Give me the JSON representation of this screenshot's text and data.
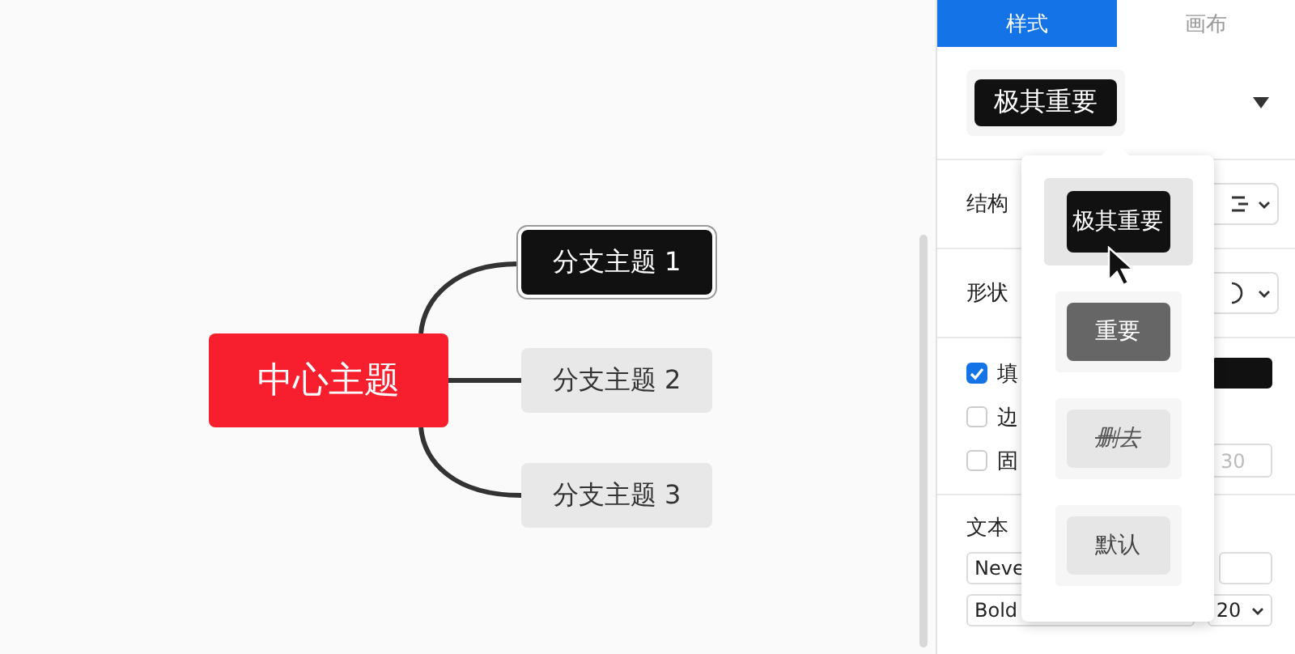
{
  "mind_map": {
    "central": {
      "label": "中心主题"
    },
    "branches": [
      {
        "label": "分支主题 1",
        "kind": "critical",
        "selected": true
      },
      {
        "label": "分支主题 2",
        "kind": "default",
        "selected": false
      },
      {
        "label": "分支主题 3",
        "kind": "default",
        "selected": false
      }
    ]
  },
  "tabs": [
    {
      "label": "样式",
      "selected": true
    },
    {
      "label": "画布",
      "selected": false
    }
  ],
  "style_preview": {
    "label": "极其重要"
  },
  "sections": {
    "structure": {
      "label": "结构"
    },
    "shape": {
      "label": "形状"
    },
    "options": [
      {
        "label": "填",
        "checked": true
      },
      {
        "label": "边",
        "checked": false
      },
      {
        "label": "固",
        "checked": false
      }
    ],
    "fixed_width": {
      "value": "30",
      "disabled": true
    },
    "text": {
      "label": "文本",
      "font": "Neve",
      "weight": "Bold",
      "size": "20"
    }
  },
  "style_menu": {
    "items": [
      {
        "label": "极其重要",
        "kind": "critical",
        "selected": true
      },
      {
        "label": "重要",
        "kind": "important",
        "selected": false
      },
      {
        "label": "删去",
        "kind": "deleted",
        "selected": false
      },
      {
        "label": "默认",
        "kind": "default",
        "selected": false
      }
    ]
  }
}
